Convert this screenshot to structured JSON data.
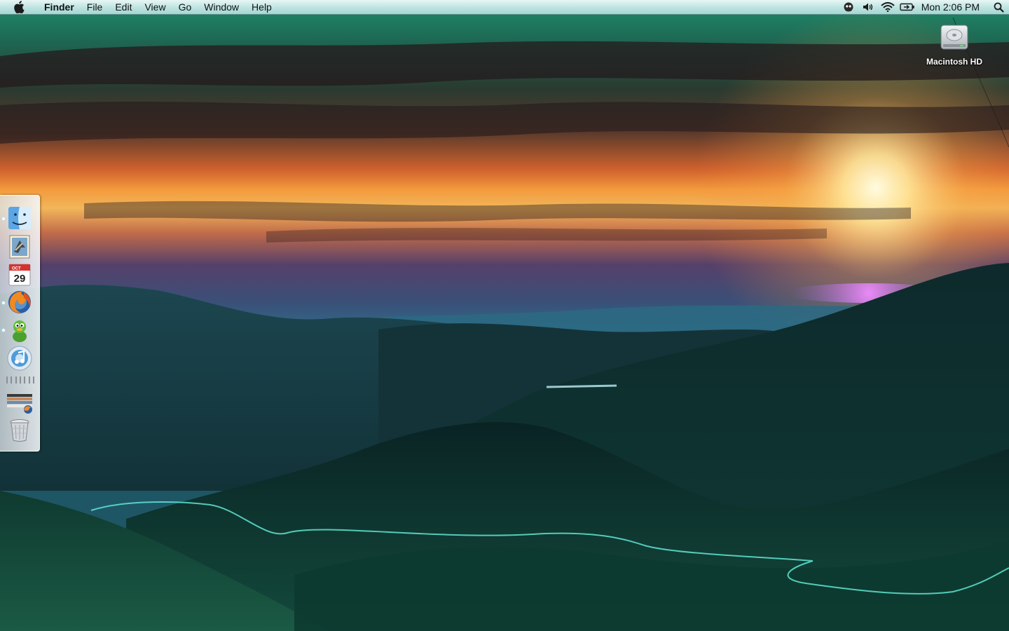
{
  "menubar": {
    "apple_icon": "apple-logo-icon",
    "app_name": "Finder",
    "menus": [
      "File",
      "Edit",
      "View",
      "Go",
      "Window",
      "Help"
    ],
    "status_icons": [
      "menu-extra-icon",
      "volume-icon",
      "wifi-icon",
      "battery-icon"
    ],
    "clock": "Mon 2:06 PM",
    "spotlight_icon": "spotlight-search-icon"
  },
  "desktop": {
    "icons": [
      {
        "label": "Macintosh HD",
        "icon": "hard-drive-icon"
      }
    ],
    "wallpaper": "sunset over mountain valley"
  },
  "dock": {
    "position": "left",
    "items": [
      {
        "name": "Finder",
        "icon": "finder-icon",
        "running": true
      },
      {
        "name": "Mail",
        "icon": "mail-icon",
        "running": false
      },
      {
        "name": "iCal",
        "icon": "ical-icon",
        "date": "29",
        "month": "OCT",
        "running": false
      },
      {
        "name": "Firefox",
        "icon": "firefox-icon",
        "running": true
      },
      {
        "name": "Adium",
        "icon": "adium-duck-icon",
        "running": true
      },
      {
        "name": "iTunes",
        "icon": "itunes-icon",
        "running": false
      },
      {
        "name": "Downloads stack",
        "icon": "downloads-stack-icon",
        "running": false
      },
      {
        "name": "Trash",
        "icon": "trash-icon",
        "running": false
      }
    ]
  },
  "colors": {
    "menubar_tint": "#b9e2df",
    "sky_top": "#1e8f6e",
    "sunset_orange": "#f08a3a",
    "sun_glow": "#fff6c8",
    "hills": "#0d2f31"
  }
}
